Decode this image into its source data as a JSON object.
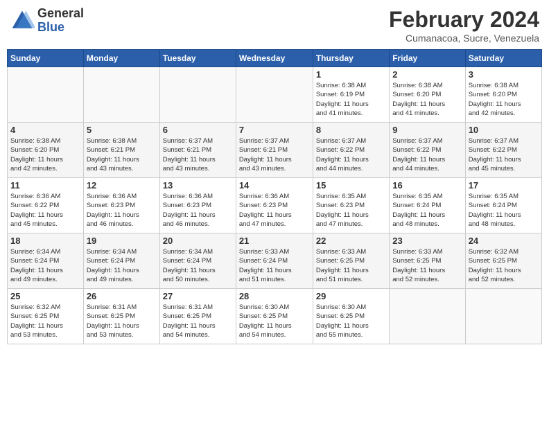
{
  "header": {
    "logo_general": "General",
    "logo_blue": "Blue",
    "month_title": "February 2024",
    "subtitle": "Cumanacoa, Sucre, Venezuela"
  },
  "days_of_week": [
    "Sunday",
    "Monday",
    "Tuesday",
    "Wednesday",
    "Thursday",
    "Friday",
    "Saturday"
  ],
  "weeks": [
    [
      {
        "day": "",
        "info": ""
      },
      {
        "day": "",
        "info": ""
      },
      {
        "day": "",
        "info": ""
      },
      {
        "day": "",
        "info": ""
      },
      {
        "day": "1",
        "info": "Sunrise: 6:38 AM\nSunset: 6:19 PM\nDaylight: 11 hours\nand 41 minutes."
      },
      {
        "day": "2",
        "info": "Sunrise: 6:38 AM\nSunset: 6:20 PM\nDaylight: 11 hours\nand 41 minutes."
      },
      {
        "day": "3",
        "info": "Sunrise: 6:38 AM\nSunset: 6:20 PM\nDaylight: 11 hours\nand 42 minutes."
      }
    ],
    [
      {
        "day": "4",
        "info": "Sunrise: 6:38 AM\nSunset: 6:20 PM\nDaylight: 11 hours\nand 42 minutes."
      },
      {
        "day": "5",
        "info": "Sunrise: 6:38 AM\nSunset: 6:21 PM\nDaylight: 11 hours\nand 43 minutes."
      },
      {
        "day": "6",
        "info": "Sunrise: 6:37 AM\nSunset: 6:21 PM\nDaylight: 11 hours\nand 43 minutes."
      },
      {
        "day": "7",
        "info": "Sunrise: 6:37 AM\nSunset: 6:21 PM\nDaylight: 11 hours\nand 43 minutes."
      },
      {
        "day": "8",
        "info": "Sunrise: 6:37 AM\nSunset: 6:22 PM\nDaylight: 11 hours\nand 44 minutes."
      },
      {
        "day": "9",
        "info": "Sunrise: 6:37 AM\nSunset: 6:22 PM\nDaylight: 11 hours\nand 44 minutes."
      },
      {
        "day": "10",
        "info": "Sunrise: 6:37 AM\nSunset: 6:22 PM\nDaylight: 11 hours\nand 45 minutes."
      }
    ],
    [
      {
        "day": "11",
        "info": "Sunrise: 6:36 AM\nSunset: 6:22 PM\nDaylight: 11 hours\nand 45 minutes."
      },
      {
        "day": "12",
        "info": "Sunrise: 6:36 AM\nSunset: 6:23 PM\nDaylight: 11 hours\nand 46 minutes."
      },
      {
        "day": "13",
        "info": "Sunrise: 6:36 AM\nSunset: 6:23 PM\nDaylight: 11 hours\nand 46 minutes."
      },
      {
        "day": "14",
        "info": "Sunrise: 6:36 AM\nSunset: 6:23 PM\nDaylight: 11 hours\nand 47 minutes."
      },
      {
        "day": "15",
        "info": "Sunrise: 6:35 AM\nSunset: 6:23 PM\nDaylight: 11 hours\nand 47 minutes."
      },
      {
        "day": "16",
        "info": "Sunrise: 6:35 AM\nSunset: 6:24 PM\nDaylight: 11 hours\nand 48 minutes."
      },
      {
        "day": "17",
        "info": "Sunrise: 6:35 AM\nSunset: 6:24 PM\nDaylight: 11 hours\nand 48 minutes."
      }
    ],
    [
      {
        "day": "18",
        "info": "Sunrise: 6:34 AM\nSunset: 6:24 PM\nDaylight: 11 hours\nand 49 minutes."
      },
      {
        "day": "19",
        "info": "Sunrise: 6:34 AM\nSunset: 6:24 PM\nDaylight: 11 hours\nand 49 minutes."
      },
      {
        "day": "20",
        "info": "Sunrise: 6:34 AM\nSunset: 6:24 PM\nDaylight: 11 hours\nand 50 minutes."
      },
      {
        "day": "21",
        "info": "Sunrise: 6:33 AM\nSunset: 6:24 PM\nDaylight: 11 hours\nand 51 minutes."
      },
      {
        "day": "22",
        "info": "Sunrise: 6:33 AM\nSunset: 6:25 PM\nDaylight: 11 hours\nand 51 minutes."
      },
      {
        "day": "23",
        "info": "Sunrise: 6:33 AM\nSunset: 6:25 PM\nDaylight: 11 hours\nand 52 minutes."
      },
      {
        "day": "24",
        "info": "Sunrise: 6:32 AM\nSunset: 6:25 PM\nDaylight: 11 hours\nand 52 minutes."
      }
    ],
    [
      {
        "day": "25",
        "info": "Sunrise: 6:32 AM\nSunset: 6:25 PM\nDaylight: 11 hours\nand 53 minutes."
      },
      {
        "day": "26",
        "info": "Sunrise: 6:31 AM\nSunset: 6:25 PM\nDaylight: 11 hours\nand 53 minutes."
      },
      {
        "day": "27",
        "info": "Sunrise: 6:31 AM\nSunset: 6:25 PM\nDaylight: 11 hours\nand 54 minutes."
      },
      {
        "day": "28",
        "info": "Sunrise: 6:30 AM\nSunset: 6:25 PM\nDaylight: 11 hours\nand 54 minutes."
      },
      {
        "day": "29",
        "info": "Sunrise: 6:30 AM\nSunset: 6:25 PM\nDaylight: 11 hours\nand 55 minutes."
      },
      {
        "day": "",
        "info": ""
      },
      {
        "day": "",
        "info": ""
      }
    ]
  ]
}
